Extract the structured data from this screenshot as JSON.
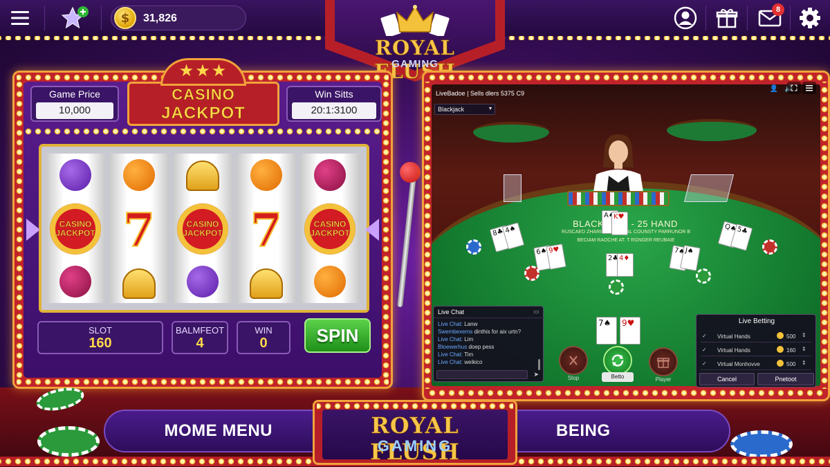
{
  "topbar": {
    "menu_icon": "hamburger-menu-icon",
    "favorite_icon": "star-plus-icon",
    "coin_symbol": "$",
    "coin_balance": "31,826",
    "profile_icon": "user-profile-icon",
    "gift_icon": "gift-icon",
    "mail_icon": "mail-icon",
    "mail_badge": "8",
    "settings_icon": "gear-icon"
  },
  "logo": {
    "title": "ROYAL FLUSH",
    "subtitle": "GAMING"
  },
  "slot": {
    "game_price_label": "Game Price",
    "game_price_value": "10,000",
    "jackpot_line1": "CASINO",
    "jackpot_line2": "JACKPOT",
    "win_label": "Win Sitts",
    "win_value": "20:1:3100",
    "reel_symbol_line1": "CASINO",
    "reel_symbol_line2": "JACKPOT",
    "stats": [
      {
        "label": "SLOT",
        "value": "160"
      },
      {
        "label": "BALMFEOT",
        "value": "4"
      },
      {
        "label": "WIN",
        "value": "0"
      }
    ],
    "spin_label": "SPIN"
  },
  "live": {
    "header_title": "LiveBadoe",
    "header_info": "| Sells dlers 5375 C9",
    "game_select": "Blackjack",
    "table_title": "BLACKJACK - 25 HAND",
    "table_sub1": "RUSCAED ZHARIRUE SEROAL COUNSTY   PARRUNOR B",
    "table_sub2": "BECIAM RAOCHE AT. T RGNGER REUBAIE",
    "chat": {
      "title": "Live Chat",
      "lines": [
        {
          "name": "Live Chat:",
          "text": "Lanw"
        },
        {
          "name": "Swembexems",
          "text": "dinthis for aix urtn?"
        },
        {
          "name": "Live Chat:",
          "text": "Lim"
        },
        {
          "name": "Btoewerhus",
          "text": "doep pess"
        },
        {
          "name": "Live Chat:",
          "text": "Tim"
        },
        {
          "name": "Live Chat:",
          "text": "weikico"
        }
      ]
    },
    "actions": [
      {
        "label": "Stop"
      },
      {
        "label": "Betto"
      },
      {
        "label": "Player"
      }
    ],
    "betting": {
      "title": "Live Betting",
      "rows": [
        {
          "name": "Virtual Hands",
          "amount": "500"
        },
        {
          "name": "Virtual Hands",
          "amount": "160"
        },
        {
          "name": "Virtual Monhovve",
          "amount": "500"
        }
      ],
      "cancel_label": "Cancel",
      "confirm_label": "Pnetoot"
    }
  },
  "bottom": {
    "left_label": "MOME MENU",
    "center_title": "ROYAL FLUSH",
    "center_sub": "GAMING",
    "right_label": "BEING"
  }
}
